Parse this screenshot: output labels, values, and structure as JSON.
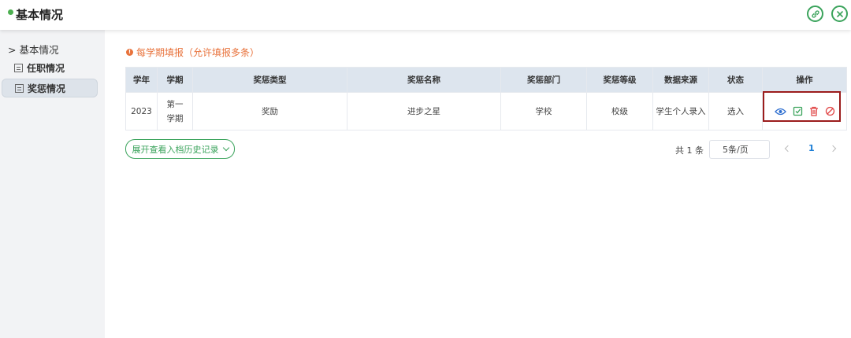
{
  "header": {
    "title": "基本情况"
  },
  "sidebar": {
    "section_label": "> 基本情况",
    "items": [
      {
        "label": "任职情况"
      },
      {
        "label": "奖惩情况",
        "active": true
      }
    ]
  },
  "main": {
    "tip": "每学期填报（允许填报多条）",
    "table": {
      "columns": [
        "学年",
        "学期",
        "奖惩类型",
        "奖惩名称",
        "奖惩部门",
        "奖惩等级",
        "数据来源",
        "状态",
        "操作"
      ],
      "rows": [
        {
          "year": "2023",
          "term": "第一学期",
          "type": "奖励",
          "name": "进步之星",
          "dept": "学校",
          "level": "校级",
          "source": "学生个人录入",
          "status": "选入",
          "actions": [
            "view-icon",
            "edit-icon",
            "delete-icon",
            "disable-icon"
          ]
        }
      ]
    },
    "expand_label": "展开查看入档历史记录",
    "pagination": {
      "total_text": "共 1 条",
      "page_size": "5条/页",
      "current_page": "1"
    }
  },
  "colors": {
    "accent_green": "#3aa35b",
    "tip_orange": "#e8723b",
    "highlight_border": "#9b1c1c",
    "page_active": "#1e7fd6"
  }
}
